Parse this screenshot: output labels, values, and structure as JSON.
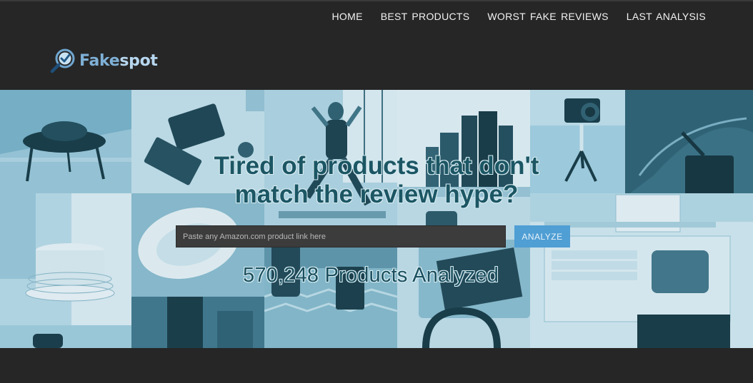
{
  "brand": {
    "name_part1": "Fake",
    "name_part2": "spot",
    "color_primary": "#7fb0d6",
    "color_light": "#b7d7ef"
  },
  "nav": {
    "items": [
      {
        "label": "HOME"
      },
      {
        "label": "BEST PRODUCTS"
      },
      {
        "label": "WORST FAKE REVIEWS"
      },
      {
        "label": "LAST ANALYSIS"
      }
    ]
  },
  "hero": {
    "headline_line1": "Tired of products that don't",
    "headline_line2": "match the review hype?",
    "search_placeholder": "Paste any Amazon.com product link here",
    "search_value": "",
    "analyze_label": "ANALYZE",
    "counter_text": "570,248 Products Analyzed",
    "accent_color": "#4f9ed4"
  },
  "icons": {
    "logo": "magnifier-check-icon"
  }
}
